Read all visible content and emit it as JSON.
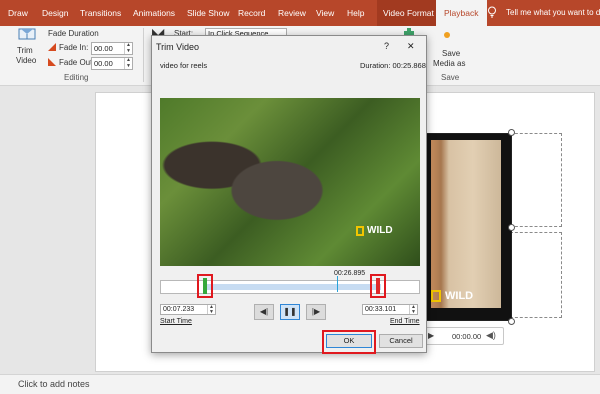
{
  "ribbon_tabs": [
    "Draw",
    "Design",
    "Transitions",
    "Animations",
    "Slide Show",
    "Record",
    "Review",
    "View",
    "Help",
    "Video Format",
    "Playback"
  ],
  "tell_me": "Tell me what you want to d",
  "editing": {
    "trim_label_1": "Trim",
    "trim_label_2": "Video",
    "fade_duration": "Fade Duration",
    "fade_in_label": "Fade In:",
    "fade_in_value": "00.00",
    "fade_out_label": "Fade Out:",
    "fade_out_value": "00.00",
    "group": "Editing"
  },
  "start": {
    "label": "Start:",
    "value": "In Click Sequence"
  },
  "save": {
    "label_1": "Save",
    "label_2": "Media as",
    "group": "Save"
  },
  "dialog": {
    "title": "Trim Video",
    "help": "?",
    "close": "✕",
    "file_name": "video for reels",
    "duration": "Duration: 00:25.868",
    "watermark": "WILD",
    "current_time": "00:26.895",
    "start_time_value": "00:07.233",
    "start_time_label": "Start Time",
    "end_time_value": "00:33.101",
    "end_time_label": "End Time",
    "ok": "OK",
    "cancel": "Cancel"
  },
  "preview": {
    "watermark": "WILD",
    "time": "00:00.00"
  },
  "notes": "Click to add notes"
}
